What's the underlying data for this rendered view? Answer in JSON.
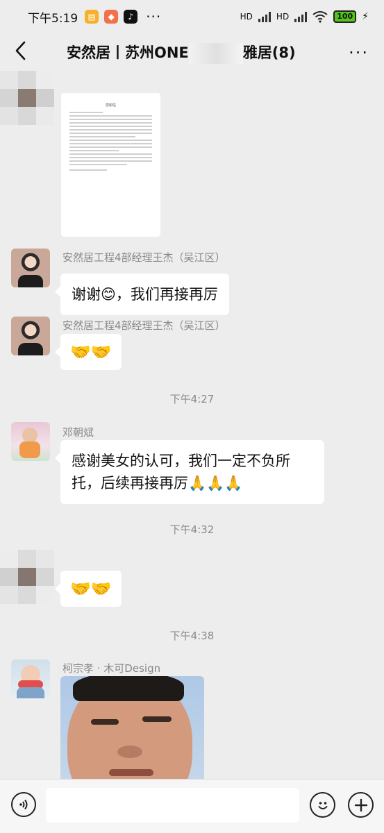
{
  "status_bar": {
    "time": "下午5:19",
    "network_1": "HD",
    "network_2": "HD",
    "battery": "100"
  },
  "nav": {
    "title_part1": "安然居丨苏州ONE",
    "title_part2": "雅居(8)",
    "more_label": "···"
  },
  "messages": {
    "m2_sender": "安然居工程4部经理王杰（吴江区）",
    "m2_text": "谢谢😊，我们再接再厉",
    "m3_sender": "安然居工程4部经理王杰（吴江区）",
    "m3_text": "🤝🤝",
    "ts1": "下午4:27",
    "m4_sender": "邓朝斌",
    "m4_text_line1": "感谢美女的认可，我们一定不负所",
    "m4_text_line2": "托，后续再接再厉🙏🙏🙏",
    "ts2": "下午4:32",
    "m5_text": "🤝🤝",
    "ts3": "下午4:38",
    "m6_sender": "柯宗孝 · 木可Design"
  },
  "doc": {
    "title": "感谢信"
  },
  "input": {
    "placeholder": ""
  }
}
